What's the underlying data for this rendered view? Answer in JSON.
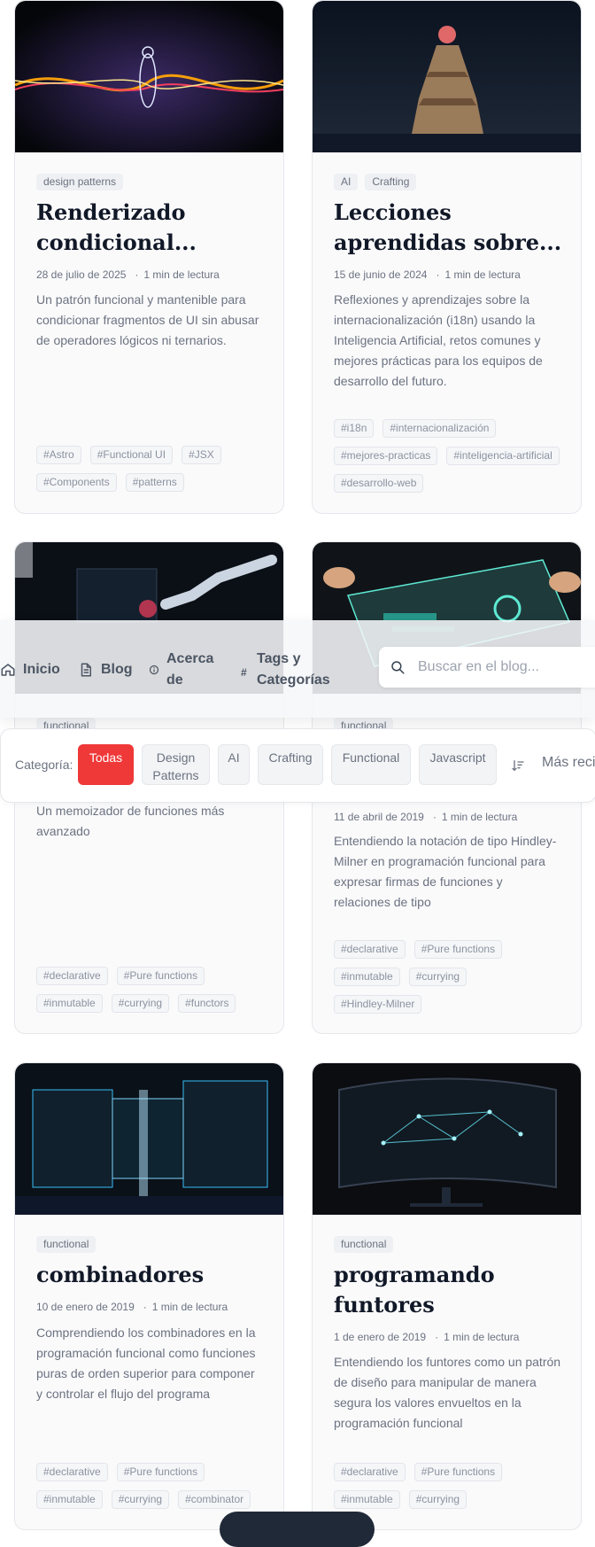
{
  "posts": [
    {
      "categories": [
        "design patterns"
      ],
      "title": "Renderizado condicional...",
      "date": "28 de julio de 2025",
      "read_time": "1 min de lectura",
      "description": "Un patrón funcional y mantenible para condicionar fragmentos de UI sin abusar de operadores lógicos ni ternarios.",
      "tags": [
        "#Astro",
        "#Functional UI",
        "#JSX",
        "#Components",
        "#patterns"
      ]
    },
    {
      "categories": [
        "AI",
        "Crafting"
      ],
      "title": "Lecciones aprendidas sobre...",
      "date": "15 de junio de 2024",
      "read_time": "1 min de lectura",
      "description": "Reflexiones y aprendizajes sobre la internacionalización (i18n) usando la Inteligencia Artificial, retos comunes y mejores prácticas para los equipos de desarrollo del futuro.",
      "tags": [
        "#i18n",
        "#internacionalización",
        "#mejores-practicas",
        "#inteligencia-artificial",
        "#desarrollo-web"
      ]
    },
    {
      "categories": [
        "functional"
      ],
      "title": "",
      "date": "",
      "read_time": "",
      "description": "Un memoizador de funciones más avanzado",
      "tags": [
        "#declarative",
        "#Pure functions",
        "#inmutable",
        "#currying",
        "#functors"
      ]
    },
    {
      "categories": [
        "functional"
      ],
      "title": "",
      "date": "11 de abril de 2019",
      "read_time": "1 min de lectura",
      "description": "Entendiendo la notación de tipo Hindley-Milner en programación funcional para expresar firmas de funciones y relaciones de tipo",
      "tags": [
        "#declarative",
        "#Pure functions",
        "#inmutable",
        "#currying",
        "#Hindley-Milner"
      ]
    },
    {
      "categories": [
        "functional"
      ],
      "title": "combinadores",
      "date": "10 de enero de 2019",
      "read_time": "1 min de lectura",
      "description": "Comprendiendo los combinadores en la programación funcional como funciones puras de orden superior para componer y controlar el flujo del programa",
      "tags": [
        "#declarative",
        "#Pure functions",
        "#inmutable",
        "#currying",
        "#combinator"
      ]
    },
    {
      "categories": [
        "functional"
      ],
      "title": "programando funtores",
      "date": "1 de enero de 2019",
      "read_time": "1 min de lectura",
      "description": "Entendiendo los funtores como un patrón de diseño para manipular de manera segura los valores envueltos en la programación funcional",
      "tags": [
        "#declarative",
        "#Pure functions",
        "#inmutable",
        "#currying"
      ]
    }
  ],
  "nav": {
    "home": "Inicio",
    "blog": "Blog",
    "about": "Acerca de",
    "tags": "Tags y Categorías",
    "search_placeholder": "Buscar en el blog..."
  },
  "filters": {
    "label": "Categoría:",
    "options": [
      "Todas",
      "Design Patterns",
      "AI",
      "Crafting",
      "Functional",
      "Javascript"
    ],
    "active": "Todas",
    "sort": "Más reci"
  },
  "colors": {
    "accent": "#ef3838",
    "text": "#111827",
    "muted": "#6b7280"
  }
}
